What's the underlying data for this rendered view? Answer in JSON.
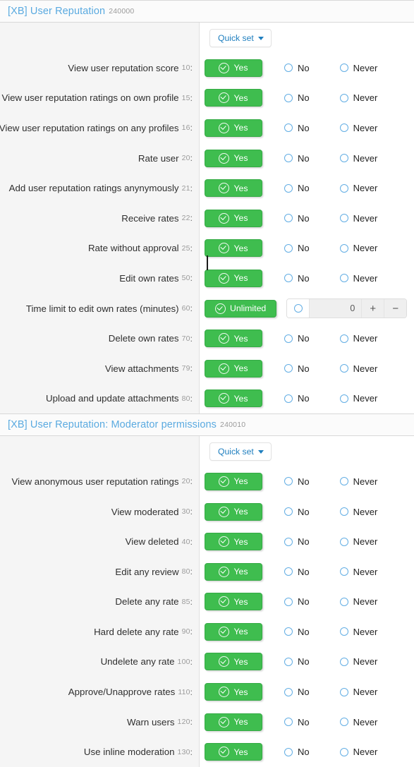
{
  "options": {
    "yes_label": "Yes",
    "unlimited_label": "Unlimited",
    "no_label": "No",
    "never_label": "Never",
    "quick_set_label": "Quick set",
    "plus_label": "+",
    "minus_label": "−",
    "colon": ":"
  },
  "colors": {
    "accent_green": "#3fbd4f",
    "link_blue": "#5aaae0",
    "quickset_blue": "#1f7fbf",
    "radio_blue": "#63aee4",
    "label_bg": "#f5f5f5"
  },
  "sections": [
    {
      "title": "[XB] User Reputation",
      "id": "240000",
      "rows": [
        {
          "label": "View user reputation score",
          "id": "10",
          "type": "yesno",
          "value": "Yes"
        },
        {
          "label": "View user reputation ratings on own profile",
          "id": "15",
          "type": "yesno",
          "value": "Yes"
        },
        {
          "label": "View user reputation ratings on any profiles",
          "id": "16",
          "type": "yesno",
          "value": "Yes"
        },
        {
          "label": "Rate user",
          "id": "20",
          "type": "yesno",
          "value": "Yes"
        },
        {
          "label": "Add user reputation ratings anynymously",
          "id": "21",
          "type": "yesno",
          "value": "Yes"
        },
        {
          "label": "Receive rates",
          "id": "22",
          "type": "yesno",
          "value": "Yes"
        },
        {
          "label": "Rate without approval",
          "id": "25",
          "type": "yesno",
          "value": "Yes"
        },
        {
          "label": "Edit own rates",
          "id": "50",
          "type": "yesno",
          "value": "Yes"
        },
        {
          "label": "Time limit to edit own rates (minutes)",
          "id": "60",
          "type": "unlimited",
          "value": "Unlimited",
          "number": "0"
        },
        {
          "label": "Delete own rates",
          "id": "70",
          "type": "yesno",
          "value": "Yes"
        },
        {
          "label": "View attachments",
          "id": "79",
          "type": "yesno",
          "value": "Yes"
        },
        {
          "label": "Upload and update attachments",
          "id": "80",
          "type": "yesno",
          "value": "Yes"
        }
      ]
    },
    {
      "title": "[XB] User Reputation: Moderator permissions",
      "id": "240010",
      "rows": [
        {
          "label": "View anonymous user reputation ratings",
          "id": "20",
          "type": "yesno",
          "value": "Yes"
        },
        {
          "label": "View moderated",
          "id": "30",
          "type": "yesno",
          "value": "Yes"
        },
        {
          "label": "View deleted",
          "id": "40",
          "type": "yesno",
          "value": "Yes"
        },
        {
          "label": "Edit any review",
          "id": "80",
          "type": "yesno",
          "value": "Yes"
        },
        {
          "label": "Delete any rate",
          "id": "85",
          "type": "yesno",
          "value": "Yes"
        },
        {
          "label": "Hard delete any rate",
          "id": "90",
          "type": "yesno",
          "value": "Yes"
        },
        {
          "label": "Undelete any rate",
          "id": "100",
          "type": "yesno",
          "value": "Yes"
        },
        {
          "label": "Approve/Unapprove rates",
          "id": "110",
          "type": "yesno",
          "value": "Yes"
        },
        {
          "label": "Warn users",
          "id": "120",
          "type": "yesno",
          "value": "Yes"
        },
        {
          "label": "Use inline moderation",
          "id": "130",
          "type": "yesno",
          "value": "Yes"
        }
      ]
    }
  ]
}
